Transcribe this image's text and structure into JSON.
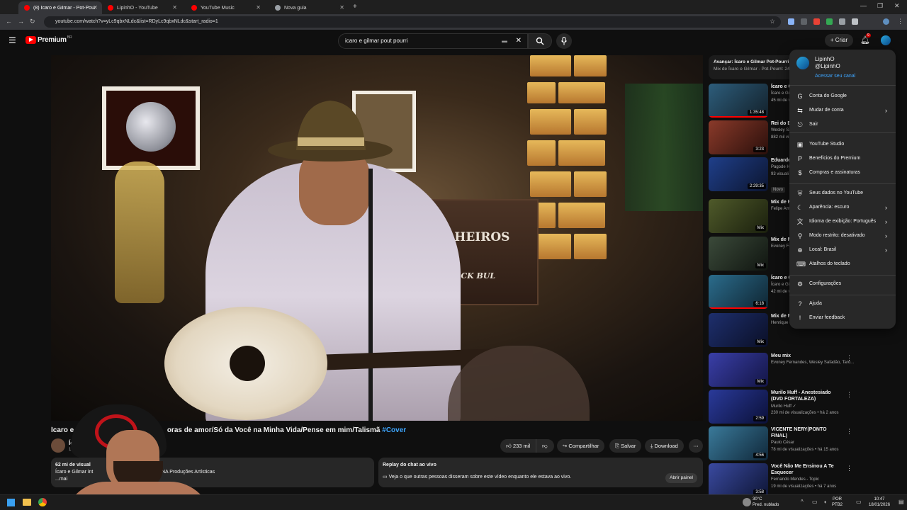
{
  "browser": {
    "tabs": [
      {
        "label": "(8) Ícaro e Gilmar - Pot-Pourri"
      },
      {
        "label": "LipinhO - YouTube"
      },
      {
        "label": "YouTube Music"
      },
      {
        "label": "Nova guia"
      }
    ],
    "url": "youtube.com/watch?v=yLc9qbxNLdc&list=RDyLc9qbxNLdc&start_radio=1"
  },
  "header": {
    "logo": "Premium",
    "logo_sup": "BR",
    "search_value": "icaro e gilmar pout pourri",
    "create_label": "Criar",
    "notif_count": "9"
  },
  "video": {
    "brand_line1": "PALHEIROS",
    "brand_line2": "BLACK BUL",
    "title_start": "Ícaro e",
    "title_end": "oras de amor/Só da Você na Minha Vida/Pense em mim/Talismã",
    "hashtag": "#Cover",
    "channel_short": "Íc",
    "subs_short": "1,3",
    "likes": "233 mil",
    "share": "Compartilhar",
    "save": "Salvar",
    "download": "Download",
    "desc_views": "62 mi de visual",
    "desc_line": "Ícaro e Gilmar int",
    "desc_credit": "NA Produções Artísticas",
    "desc_more": "...mai",
    "chat_title": "Replay do chat ao vivo",
    "chat_text": "Veja o que outras pessoas disseram sobre este vídeo enquanto ele estava ao vivo.",
    "chat_btn": "Abrir painel"
  },
  "sidebar": {
    "upnext_title": "Avançar: Ícaro e Gilmar Pot-Pourri",
    "upnext_sub": "Mix de Ícaro e Gilmar - Pot-Pourri: 24 ho",
    "items": [
      {
        "title": "Ícaro e G DVD CON",
        "line1": "Ícaro e Gil",
        "line2": "45 mi de v",
        "dur": "1:35:48",
        "c1": "#2d5d7b",
        "c2": "#13212b"
      },
      {
        "title": "Rei do B",
        "line1": "Wesley Sa",
        "line2": "882 mil vi",
        "dur": "3:23",
        "c1": "#8a3a2a",
        "c2": "#2a0f0b"
      },
      {
        "title": "Eduardo Gusttavo",
        "line1": "Pagode H",
        "line2": "93 visuali",
        "dur": "2:29:35",
        "c1": "#1f3f8a",
        "c2": "#0c1530"
      },
      {
        "title": "Mix de F @Gustav",
        "line1": "Felipe Am",
        "line2": "",
        "dur": "Mix",
        "c1": "#4f5a2a",
        "c2": "#1a1f0d"
      },
      {
        "title": "Mix de M",
        "line1": "Evoney Fe",
        "line2": "",
        "dur": "Mix",
        "c1": "#3b4a3a",
        "c2": "#101510"
      },
      {
        "title": "Ícaro e G Deixaria",
        "line1": "Ícaro e Gil",
        "line2": "42 mi de v",
        "dur": "6:18",
        "c1": "#2b6c8c",
        "c2": "#0f2532"
      },
      {
        "title": "Mix de M",
        "line1": "Henrique &",
        "line2": "",
        "dur": "Mix",
        "c1": "#1e2f6d",
        "c2": "#0a0f26"
      },
      {
        "title": "Meu mix",
        "line1": "Evoney Fernandes, Wesley Safadão, Taro...",
        "line2": "",
        "dur": "Mix",
        "c1": "#3a3fa8",
        "c2": "#131545"
      },
      {
        "title": "Murilo Huff - Anestesiado (DVD FORTALEZA)",
        "line1": "Murilo Huff ✓",
        "line2": "230 mi de visualizações • há 2 anos",
        "dur": "2:59",
        "c1": "#2a3a9a",
        "c2": "#0b1038"
      },
      {
        "title": "VICENTE NERY(PONTO FINAL)",
        "line1": "Paulo César",
        "line2": "78 mi de visualizações • há 15 anos",
        "dur": "4:56",
        "c1": "#3a7a9a",
        "c2": "#10283a"
      },
      {
        "title": "Você Não Me Ensinou A Te Esquecer",
        "line1": "Fernando Mendes - Topic",
        "line2": "19 mi de visualizações • há 7 anos",
        "dur": "3:58",
        "c1": "#3a4aa0",
        "c2": "#0e1535"
      }
    ],
    "tag_new": "Novo"
  },
  "account_menu": {
    "name": "LipinhO",
    "handle": "@LipinhO",
    "channel_link": "Acessar seu canal",
    "items": [
      {
        "label": "Conta do Google",
        "icon": "G",
        "arrow": ""
      },
      {
        "label": "Mudar de conta",
        "icon": "⇆",
        "arrow": "›"
      },
      {
        "label": "Sair",
        "icon": "⎋",
        "arrow": ""
      },
      {
        "label": "YouTube Studio",
        "icon": "▣",
        "arrow": ""
      },
      {
        "label": "Benefícios do Premium",
        "icon": "P",
        "arrow": ""
      },
      {
        "label": "Compras e assinaturas",
        "icon": "$",
        "arrow": ""
      },
      {
        "label": "Seus dados no YouTube",
        "icon": "⛨",
        "arrow": ""
      },
      {
        "label": "Aparência: escuro",
        "icon": "☾",
        "arrow": "›"
      },
      {
        "label": "Idioma de exibição: Português",
        "icon": "文",
        "arrow": "›"
      },
      {
        "label": "Modo restrito: desativado",
        "icon": "⚲",
        "arrow": "›"
      },
      {
        "label": "Local: Brasil",
        "icon": "⊕",
        "arrow": "›"
      },
      {
        "label": "Atalhos do teclado",
        "icon": "⌨",
        "arrow": ""
      },
      {
        "label": "Configurações",
        "icon": "⚙",
        "arrow": ""
      },
      {
        "label": "Ajuda",
        "icon": "?",
        "arrow": ""
      },
      {
        "label": "Enviar feedback",
        "icon": "!",
        "arrow": ""
      }
    ]
  },
  "taskbar": {
    "weather_temp": "30°C",
    "weather_desc": "Pred. nublado",
    "lang1": "POR",
    "lang2": "PTB2",
    "time": "10:47",
    "date": "18/01/2026"
  }
}
